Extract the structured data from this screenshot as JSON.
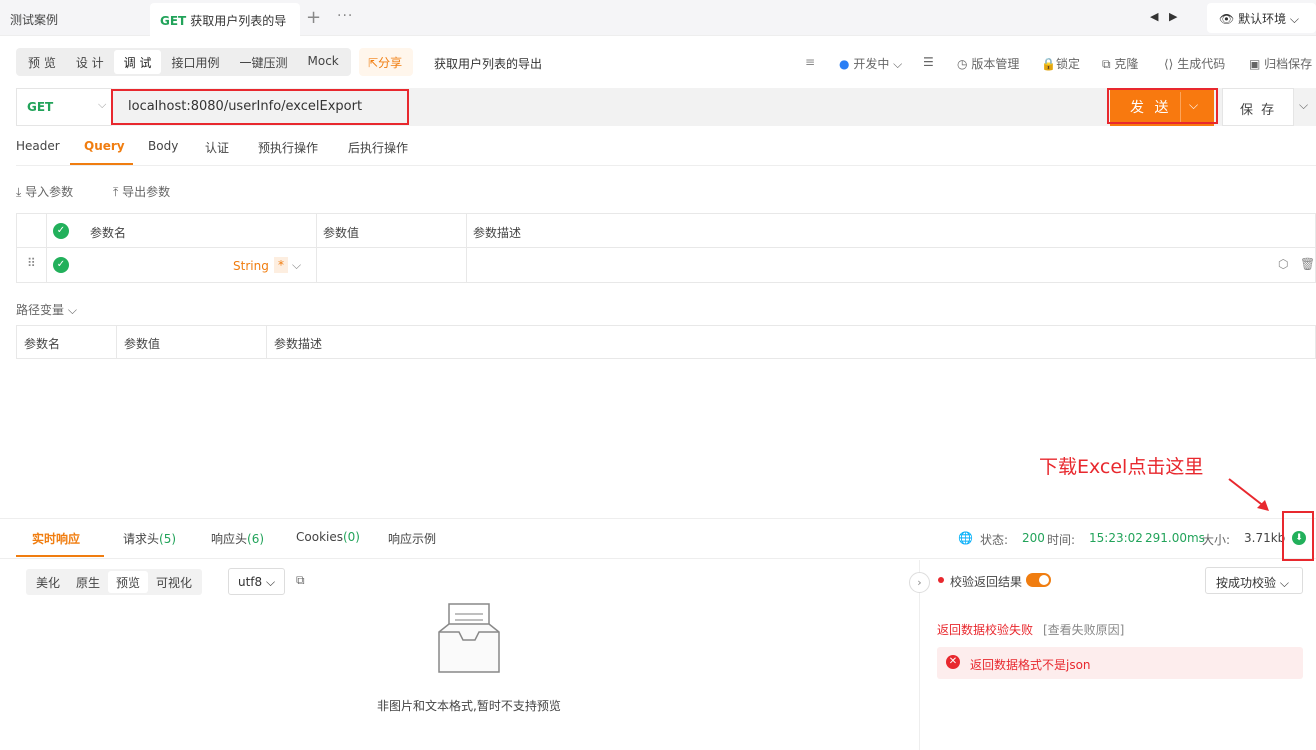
{
  "tabs": {
    "tab1": "测试案例",
    "tab2_method": "GET",
    "tab2_label": "获取用户列表的导",
    "plus": "+",
    "more": "···"
  },
  "env": {
    "label": "默认环境"
  },
  "modes": [
    "预 览",
    "设 计",
    "调 试",
    "接口用例",
    "一键压测",
    "Mock"
  ],
  "share_label": "分享",
  "api_name": "获取用户列表的导出",
  "toolbar": {
    "dev": "开发中",
    "version": "版本管理",
    "lock": "锁定",
    "clone": "克隆",
    "gencode": "生成代码",
    "archive": "归档保存"
  },
  "request": {
    "method": "GET",
    "url": "localhost:8080/userInfo/excelExport",
    "send": "发 送",
    "save": "保 存"
  },
  "subtabs": [
    "Header",
    "Query",
    "Body",
    "认证",
    "预执行操作",
    "后执行操作"
  ],
  "query": {
    "import": "导入参数",
    "export": "导出参数",
    "col_name": "参数名",
    "col_value": "参数值",
    "col_desc": "参数描述",
    "type": "String",
    "required": "*"
  },
  "path_vars": {
    "title": "路径变量",
    "col_name": "参数名",
    "col_value": "参数值",
    "col_desc": "参数描述"
  },
  "annotation": "下载Excel点击这里",
  "response": {
    "tabs": [
      "实时响应",
      "请求头",
      "响应头",
      "Cookies",
      "响应示例"
    ],
    "counts": [
      "",
      "(5)",
      "(6)",
      "(0)",
      ""
    ],
    "status_label": "状态:",
    "status": "200",
    "time_label": "时间:",
    "time": "15:23:02",
    "duration": "291.00ms",
    "size_label": "大小:",
    "size": "3.71kb",
    "view_modes": [
      "美化",
      "原生",
      "预览",
      "可视化"
    ],
    "encoding": "utf8",
    "no_preview": "非图片和文本格式,暂时不支持预览",
    "validate_label": "校验返回结果",
    "validate_select": "按成功校验",
    "fail_text": "返回数据校验失败",
    "fail_reason": "[查看失败原因]",
    "error": "返回数据格式不是json"
  },
  "colors": {
    "accent": "#f07d10",
    "green": "#22a35a",
    "red": "#e8282e"
  }
}
